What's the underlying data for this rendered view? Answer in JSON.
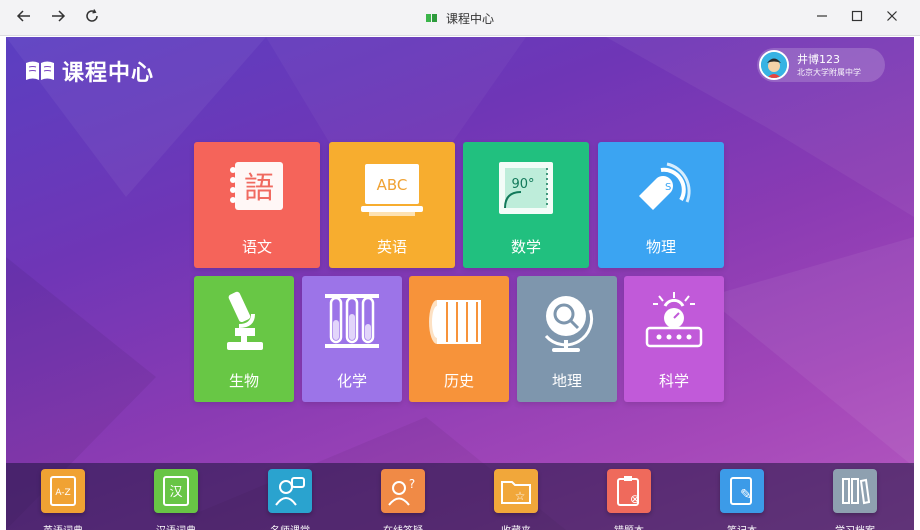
{
  "window": {
    "title": "课程中心",
    "back_icon": "back-arrow-icon",
    "forward_icon": "forward-arrow-icon",
    "refresh_icon": "refresh-icon",
    "controls": [
      "minimize-icon",
      "maximize-icon",
      "close-icon"
    ]
  },
  "header": {
    "brand_title": "课程中心",
    "user": {
      "name": "井博123",
      "school": "北京大学附属中学"
    }
  },
  "subjects": [
    {
      "label": "语文",
      "color": "#f5645a",
      "icon": "chinese-notebook-icon"
    },
    {
      "label": "英语",
      "color": "#f7ad2f",
      "icon": "abc-board-icon"
    },
    {
      "label": "数学",
      "color": "#21c07f",
      "icon": "protractor-icon"
    },
    {
      "label": "物理",
      "color": "#3ba4f2",
      "icon": "magnet-icon"
    },
    {
      "label": "生物",
      "color": "#68c745",
      "icon": "microscope-icon"
    },
    {
      "label": "化学",
      "color": "#9c74e8",
      "icon": "test-tubes-icon"
    },
    {
      "label": "历史",
      "color": "#f7933a",
      "icon": "scroll-icon"
    },
    {
      "label": "地理",
      "color": "#7e96ad",
      "icon": "globe-icon"
    },
    {
      "label": "科学",
      "color": "#c15ad9",
      "icon": "science-machine-icon"
    }
  ],
  "dock": [
    {
      "label": "英语词典",
      "color": "#f0a233",
      "icon": "english-dictionary-icon",
      "glyph": "A-Z"
    },
    {
      "label": "汉语词典",
      "color": "#68c545",
      "icon": "chinese-dictionary-icon",
      "glyph": "汉"
    },
    {
      "label": "名师课堂",
      "color": "#2aa3cf",
      "icon": "teacher-class-icon",
      "glyph": ""
    },
    {
      "label": "在线答疑",
      "color": "#f08a46",
      "icon": "online-qa-icon",
      "glyph": "?"
    },
    {
      "label": "收藏夹",
      "color": "#f1a73a",
      "icon": "favorites-folder-icon",
      "glyph": "☆"
    },
    {
      "label": "错题本",
      "color": "#ef6a5c",
      "icon": "mistake-book-icon",
      "glyph": "⊗"
    },
    {
      "label": "笔记本",
      "color": "#3c9be8",
      "icon": "notebook-icon",
      "glyph": "✎"
    },
    {
      "label": "学习档案",
      "color": "#8ea0b0",
      "icon": "study-archive-icon",
      "glyph": ""
    }
  ]
}
